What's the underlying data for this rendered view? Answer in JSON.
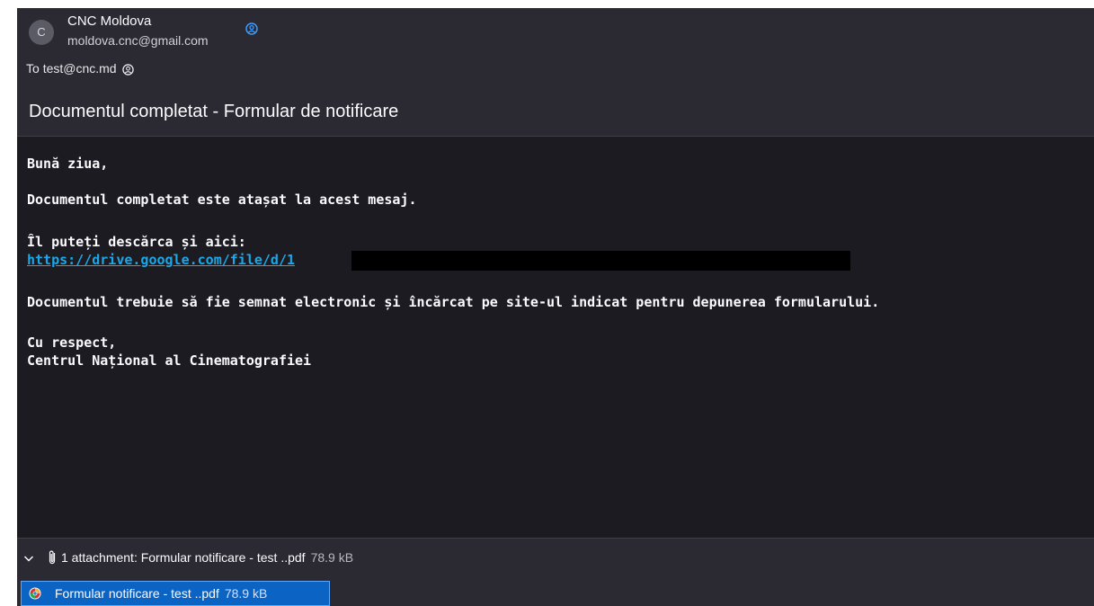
{
  "sender": {
    "avatar_initial": "C",
    "name": "CNC Moldova",
    "email": "moldova.cnc@gmail.com"
  },
  "recipient": {
    "prefix": "To",
    "email": "test@cnc.md"
  },
  "subject": "Documentul completat - Formular de notificare",
  "body": {
    "greeting": "Bună ziua,",
    "line1": "Documentul completat este atașat la acest mesaj.",
    "line2": "Îl puteți descărca și aici:",
    "link": "https://drive.google.com/file/d/1",
    "line3": "Documentul trebuie să fie semnat electronic și încărcat pe site-ul indicat pentru depunerea formularului.",
    "closing": "Cu respect,",
    "signature": "Centrul Național al Cinematografiei"
  },
  "attachments": {
    "summary": "1 attachment: Formular notificare - test ..pdf",
    "summary_size": "78.9 kB",
    "items": [
      {
        "name": "Formular notificare - test ..pdf",
        "size": "78.9 kB"
      }
    ]
  },
  "colors": {
    "link": "#1ba8e8",
    "selected_attachment": "#0b64c4"
  }
}
